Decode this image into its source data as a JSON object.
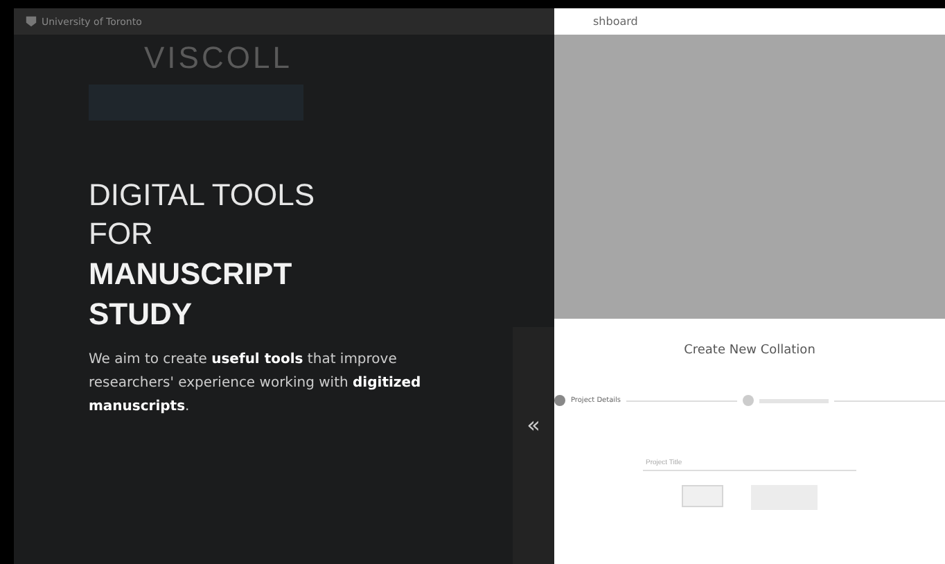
{
  "header": {
    "logo_text": "University of Toronto",
    "crumb": "shboard"
  },
  "background_app": {
    "title": "VISCOLL"
  },
  "hero": {
    "light_lines": [
      "DIGITAL TOOLS",
      "FOR"
    ],
    "bold_lines": [
      "MANUSCRIPT",
      "STUDY"
    ],
    "text": "We aim to create **useful tools** that improve researchers' experience working with **digitized manuscripts**."
  },
  "sidebar_toggle": {
    "label": "«"
  },
  "modal": {
    "title": "Create New Collation",
    "steps": [
      {
        "label": "Project Details",
        "selected": true
      },
      {
        "selected": false
      }
    ],
    "field": {
      "placeholder": "Project Title"
    }
  }
}
